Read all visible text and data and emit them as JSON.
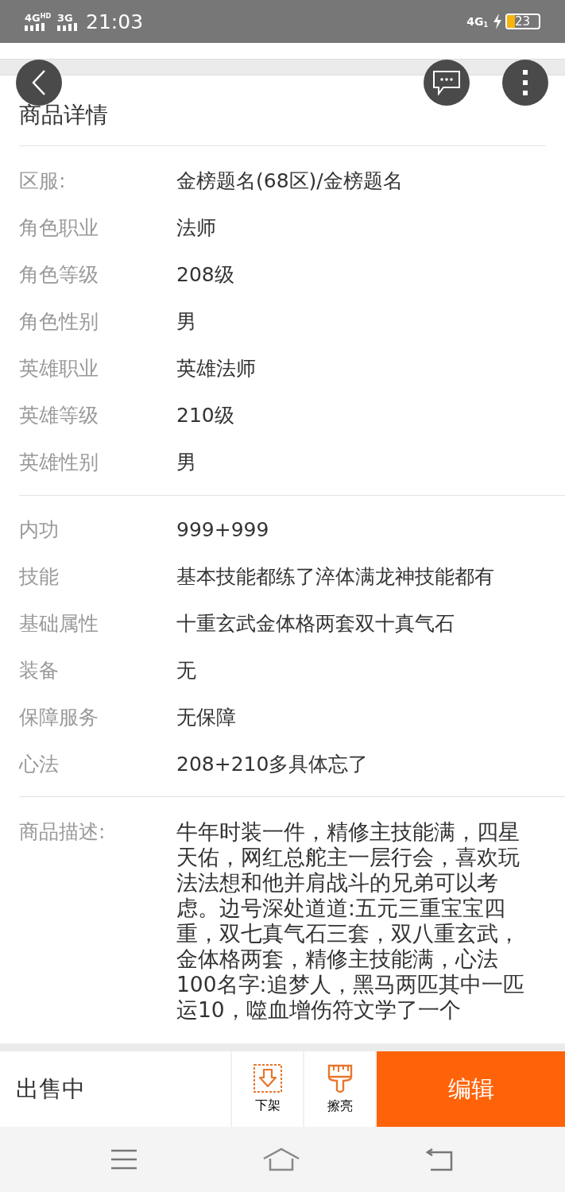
{
  "status_bar": {
    "network_1": "4G",
    "network_1_sup": "HD",
    "network_2": "3G",
    "time": "21:03",
    "network_3": "4G",
    "network_3_sub": "1",
    "battery": "23",
    "charging": true
  },
  "header": {
    "title": "商品详情"
  },
  "sections": [
    {
      "rows": [
        {
          "label": "区服:",
          "value": "金榜题名(68区)/金榜题名"
        },
        {
          "label": "角色职业",
          "value": "法师"
        },
        {
          "label": "角色等级",
          "value": "208级"
        },
        {
          "label": "角色性别",
          "value": "男"
        },
        {
          "label": "英雄职业",
          "value": "英雄法师"
        },
        {
          "label": "英雄等级",
          "value": "210级"
        },
        {
          "label": "英雄性别",
          "value": "男"
        }
      ]
    },
    {
      "rows": [
        {
          "label": "内功",
          "value": "999+999"
        },
        {
          "label": "技能",
          "value": "基本技能都练了淬体满龙神技能都有"
        },
        {
          "label": "基础属性",
          "value": "十重玄武金体格两套双十真气石"
        },
        {
          "label": "装备",
          "value": "无"
        },
        {
          "label": "保障服务",
          "value": "无保障"
        },
        {
          "label": "心法",
          "value": "208+210多具体忘了"
        }
      ]
    }
  ],
  "description": {
    "label": "商品描述:",
    "value": "牛年时装一件，精修主技能满，四星天佑，网红总舵主一层行会，喜欢玩法法想和他并肩战斗的兄弟可以考虑。边号深处道道:五元三重宝宝四重，双七真气石三套，双八重玄武，金体格两套，精修主技能满，心法100名字:追梦人，黑马两匹其中一匹运10，噬血增伤符文学了一个"
  },
  "action_bar": {
    "status": "出售中",
    "actions": [
      {
        "kind": "delist",
        "label": "下架"
      },
      {
        "kind": "polish",
        "label": "擦亮"
      }
    ],
    "primary": "编辑"
  }
}
